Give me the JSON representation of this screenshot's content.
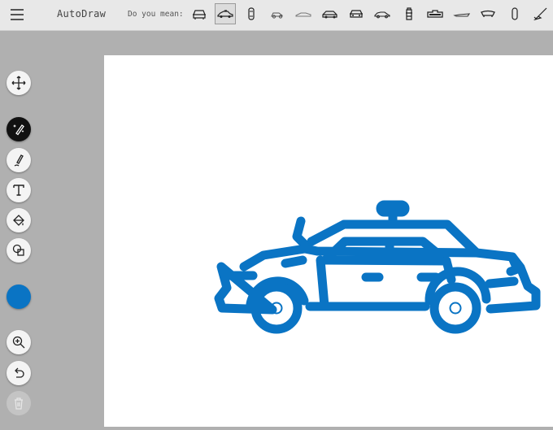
{
  "app": {
    "title": "AutoDraw"
  },
  "suggestions": {
    "label": "Do you mean:",
    "items": [
      {
        "name": "suggestion-car-front",
        "selected": false
      },
      {
        "name": "suggestion-police-car",
        "selected": true
      },
      {
        "name": "suggestion-car-top",
        "selected": false
      },
      {
        "name": "suggestion-car-outline",
        "selected": false
      },
      {
        "name": "suggestion-sports-car",
        "selected": false
      },
      {
        "name": "suggestion-sedan",
        "selected": false
      },
      {
        "name": "suggestion-car-front-2",
        "selected": false
      },
      {
        "name": "suggestion-car-side",
        "selected": false
      },
      {
        "name": "suggestion-fire-hydrant",
        "selected": false
      },
      {
        "name": "suggestion-truck",
        "selected": false
      },
      {
        "name": "suggestion-boat",
        "selected": false
      },
      {
        "name": "suggestion-skateboard",
        "selected": false
      },
      {
        "name": "suggestion-capsule",
        "selected": false
      },
      {
        "name": "suggestion-broom",
        "selected": false
      }
    ]
  },
  "toolbar": {
    "tools": [
      "move-icon",
      "autodraw-icon",
      "draw-icon",
      "type-icon",
      "fill-icon",
      "shape-icon",
      "zoom-icon",
      "undo-icon",
      "delete-icon"
    ]
  },
  "colors": {
    "selected": "#0a74c4",
    "ink": "#0a74c4",
    "topbar": "#e8e8e8",
    "side": "#b0b0b0"
  }
}
